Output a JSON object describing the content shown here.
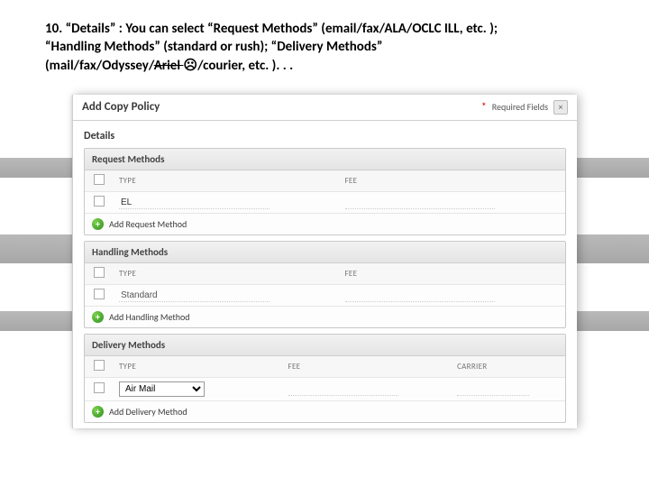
{
  "caption": {
    "num": "10.",
    "lead": "“Details” :",
    "text_a": "You can select “Request Methods” (email/fax/ALA/OCLC ILL, etc. );",
    "text_b": "“Handling Methods” (standard or rush); “Delivery Methods”",
    "text_c1": "(mail/fax/Odyssey/",
    "text_strike": "Ariel ",
    "text_sad": "☹",
    "text_c2": "/courier, etc. ). . ."
  },
  "panel": {
    "title": "Add Copy Policy",
    "required": "Required Fields",
    "close": "×"
  },
  "details": {
    "label": "Details"
  },
  "request": {
    "header": "Request Methods",
    "col_type": "TYPE",
    "col_fee": "FEE",
    "row_value": "EL",
    "add_label": "Add Request Method"
  },
  "handling": {
    "header": "Handling Methods",
    "col_type": "TYPE",
    "col_fee": "FEE",
    "row_value": "Standard",
    "add_label": "Add  Handling Method"
  },
  "delivery": {
    "header": "Delivery Methods",
    "col_type": "TYPE",
    "col_fee": "FEE",
    "col_carrier": "CARRIER",
    "row_value": "Air Mail",
    "add_label": "Add Delivery Method"
  }
}
